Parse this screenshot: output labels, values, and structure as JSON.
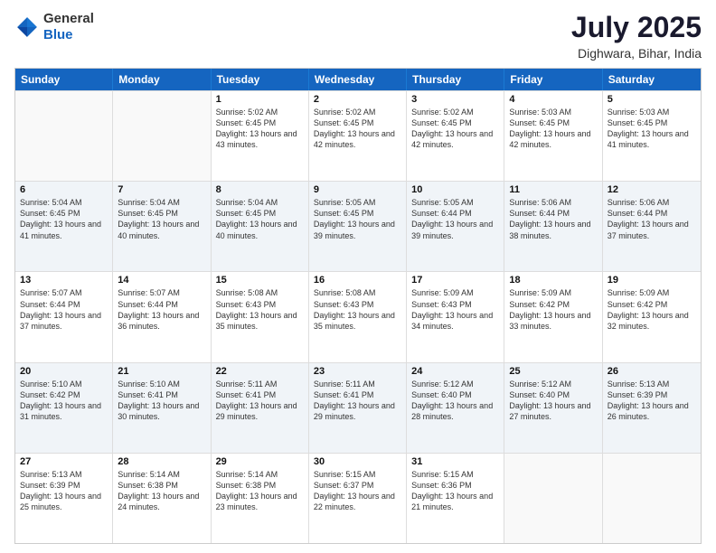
{
  "logo": {
    "general": "General",
    "blue": "Blue"
  },
  "title": "July 2025",
  "subtitle": "Dighwara, Bihar, India",
  "days": [
    "Sunday",
    "Monday",
    "Tuesday",
    "Wednesday",
    "Thursday",
    "Friday",
    "Saturday"
  ],
  "weeks": [
    [
      {
        "day": "",
        "info": ""
      },
      {
        "day": "",
        "info": ""
      },
      {
        "day": "1",
        "info": "Sunrise: 5:02 AM\nSunset: 6:45 PM\nDaylight: 13 hours and 43 minutes."
      },
      {
        "day": "2",
        "info": "Sunrise: 5:02 AM\nSunset: 6:45 PM\nDaylight: 13 hours and 42 minutes."
      },
      {
        "day": "3",
        "info": "Sunrise: 5:02 AM\nSunset: 6:45 PM\nDaylight: 13 hours and 42 minutes."
      },
      {
        "day": "4",
        "info": "Sunrise: 5:03 AM\nSunset: 6:45 PM\nDaylight: 13 hours and 42 minutes."
      },
      {
        "day": "5",
        "info": "Sunrise: 5:03 AM\nSunset: 6:45 PM\nDaylight: 13 hours and 41 minutes."
      }
    ],
    [
      {
        "day": "6",
        "info": "Sunrise: 5:04 AM\nSunset: 6:45 PM\nDaylight: 13 hours and 41 minutes."
      },
      {
        "day": "7",
        "info": "Sunrise: 5:04 AM\nSunset: 6:45 PM\nDaylight: 13 hours and 40 minutes."
      },
      {
        "day": "8",
        "info": "Sunrise: 5:04 AM\nSunset: 6:45 PM\nDaylight: 13 hours and 40 minutes."
      },
      {
        "day": "9",
        "info": "Sunrise: 5:05 AM\nSunset: 6:45 PM\nDaylight: 13 hours and 39 minutes."
      },
      {
        "day": "10",
        "info": "Sunrise: 5:05 AM\nSunset: 6:44 PM\nDaylight: 13 hours and 39 minutes."
      },
      {
        "day": "11",
        "info": "Sunrise: 5:06 AM\nSunset: 6:44 PM\nDaylight: 13 hours and 38 minutes."
      },
      {
        "day": "12",
        "info": "Sunrise: 5:06 AM\nSunset: 6:44 PM\nDaylight: 13 hours and 37 minutes."
      }
    ],
    [
      {
        "day": "13",
        "info": "Sunrise: 5:07 AM\nSunset: 6:44 PM\nDaylight: 13 hours and 37 minutes."
      },
      {
        "day": "14",
        "info": "Sunrise: 5:07 AM\nSunset: 6:44 PM\nDaylight: 13 hours and 36 minutes."
      },
      {
        "day": "15",
        "info": "Sunrise: 5:08 AM\nSunset: 6:43 PM\nDaylight: 13 hours and 35 minutes."
      },
      {
        "day": "16",
        "info": "Sunrise: 5:08 AM\nSunset: 6:43 PM\nDaylight: 13 hours and 35 minutes."
      },
      {
        "day": "17",
        "info": "Sunrise: 5:09 AM\nSunset: 6:43 PM\nDaylight: 13 hours and 34 minutes."
      },
      {
        "day": "18",
        "info": "Sunrise: 5:09 AM\nSunset: 6:42 PM\nDaylight: 13 hours and 33 minutes."
      },
      {
        "day": "19",
        "info": "Sunrise: 5:09 AM\nSunset: 6:42 PM\nDaylight: 13 hours and 32 minutes."
      }
    ],
    [
      {
        "day": "20",
        "info": "Sunrise: 5:10 AM\nSunset: 6:42 PM\nDaylight: 13 hours and 31 minutes."
      },
      {
        "day": "21",
        "info": "Sunrise: 5:10 AM\nSunset: 6:41 PM\nDaylight: 13 hours and 30 minutes."
      },
      {
        "day": "22",
        "info": "Sunrise: 5:11 AM\nSunset: 6:41 PM\nDaylight: 13 hours and 29 minutes."
      },
      {
        "day": "23",
        "info": "Sunrise: 5:11 AM\nSunset: 6:41 PM\nDaylight: 13 hours and 29 minutes."
      },
      {
        "day": "24",
        "info": "Sunrise: 5:12 AM\nSunset: 6:40 PM\nDaylight: 13 hours and 28 minutes."
      },
      {
        "day": "25",
        "info": "Sunrise: 5:12 AM\nSunset: 6:40 PM\nDaylight: 13 hours and 27 minutes."
      },
      {
        "day": "26",
        "info": "Sunrise: 5:13 AM\nSunset: 6:39 PM\nDaylight: 13 hours and 26 minutes."
      }
    ],
    [
      {
        "day": "27",
        "info": "Sunrise: 5:13 AM\nSunset: 6:39 PM\nDaylight: 13 hours and 25 minutes."
      },
      {
        "day": "28",
        "info": "Sunrise: 5:14 AM\nSunset: 6:38 PM\nDaylight: 13 hours and 24 minutes."
      },
      {
        "day": "29",
        "info": "Sunrise: 5:14 AM\nSunset: 6:38 PM\nDaylight: 13 hours and 23 minutes."
      },
      {
        "day": "30",
        "info": "Sunrise: 5:15 AM\nSunset: 6:37 PM\nDaylight: 13 hours and 22 minutes."
      },
      {
        "day": "31",
        "info": "Sunrise: 5:15 AM\nSunset: 6:36 PM\nDaylight: 13 hours and 21 minutes."
      },
      {
        "day": "",
        "info": ""
      },
      {
        "day": "",
        "info": ""
      }
    ]
  ]
}
